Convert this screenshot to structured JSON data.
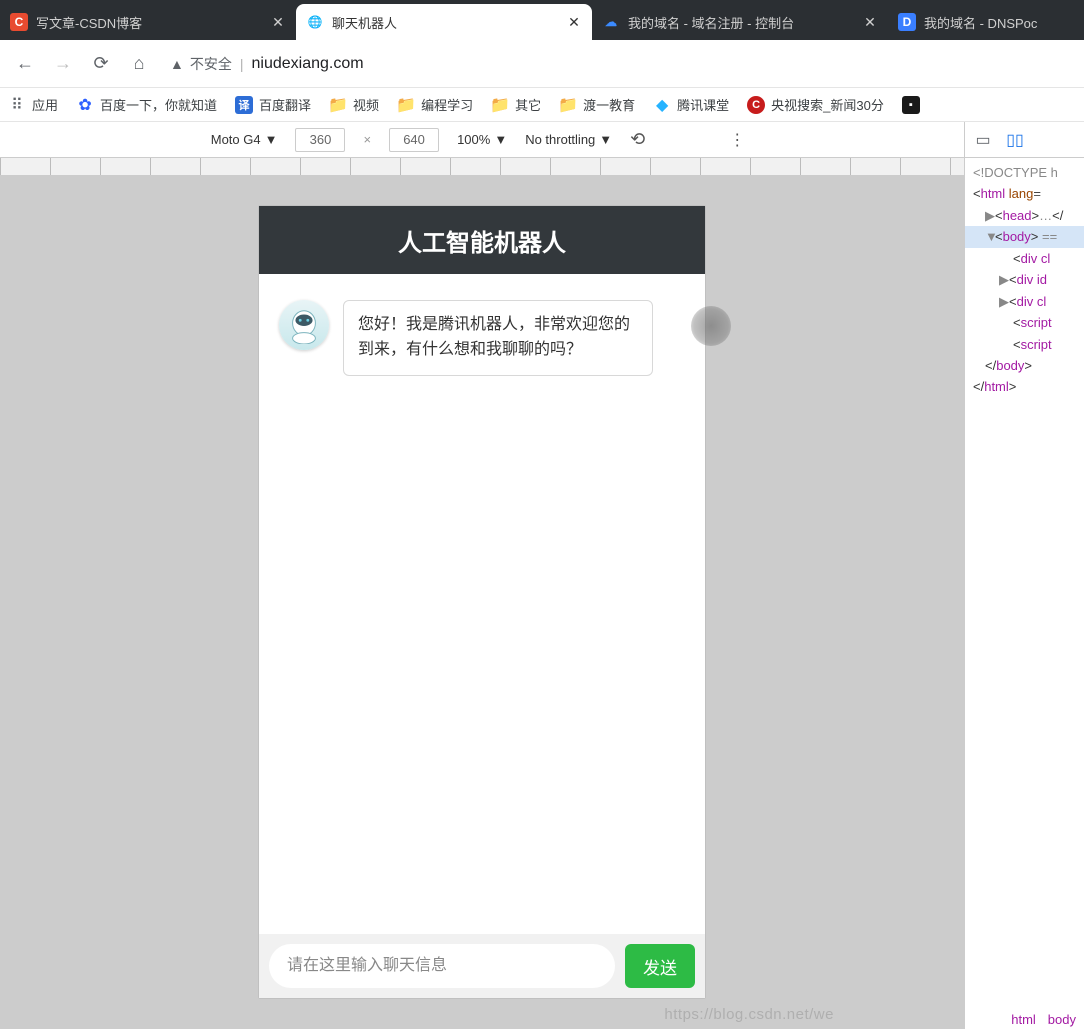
{
  "browser": {
    "tabs": [
      {
        "title": "写文章-CSDN博客",
        "favicon": "C",
        "active": false
      },
      {
        "title": "聊天机器人",
        "favicon": "globe",
        "active": true
      },
      {
        "title": "我的域名 - 域名注册 - 控制台",
        "favicon": "cloud",
        "active": false
      },
      {
        "title": "我的域名 - DNSPoc",
        "favicon": "D",
        "active": false
      }
    ],
    "url_insecure": "不安全",
    "url_sep": "|",
    "url_host": "niudexiang.com"
  },
  "bookmarks": [
    {
      "icon": "apps",
      "label": "应用"
    },
    {
      "icon": "baidu",
      "label": "百度一下，你就知道"
    },
    {
      "icon": "trans",
      "label": "百度翻译"
    },
    {
      "icon": "folder",
      "label": "视频"
    },
    {
      "icon": "folder",
      "label": "编程学习"
    },
    {
      "icon": "folder",
      "label": "其它"
    },
    {
      "icon": "folder",
      "label": "渡一教育"
    },
    {
      "icon": "tx",
      "label": "腾讯课堂"
    },
    {
      "icon": "cctv",
      "label": "央视搜索_新闻30分"
    },
    {
      "icon": "dark",
      "label": ""
    }
  ],
  "devtools": {
    "device": "Moto G4",
    "width": "360",
    "height": "640",
    "zoom": "100%",
    "throttle": "No throttling"
  },
  "chat": {
    "header": "人工智能机器人",
    "bot_message": "您好！我是腾讯机器人，非常欢迎您的到来，有什么想和我聊聊的吗？",
    "input_placeholder": "请在这里输入聊天信息",
    "send_label": "发送"
  },
  "code": {
    "doctype": "<!DOCTYPE h",
    "html_open": "html",
    "html_attr": "lang",
    "head": "head",
    "head_dots": "…",
    "body": "body",
    "body_eq": " ==",
    "div_cl": "div cl",
    "div_id": "div id",
    "script": "script",
    "body_close": "body",
    "html_close": "html",
    "crumb_html": "html",
    "crumb_body": "body"
  },
  "watermark": "https://blog.csdn.net/we"
}
